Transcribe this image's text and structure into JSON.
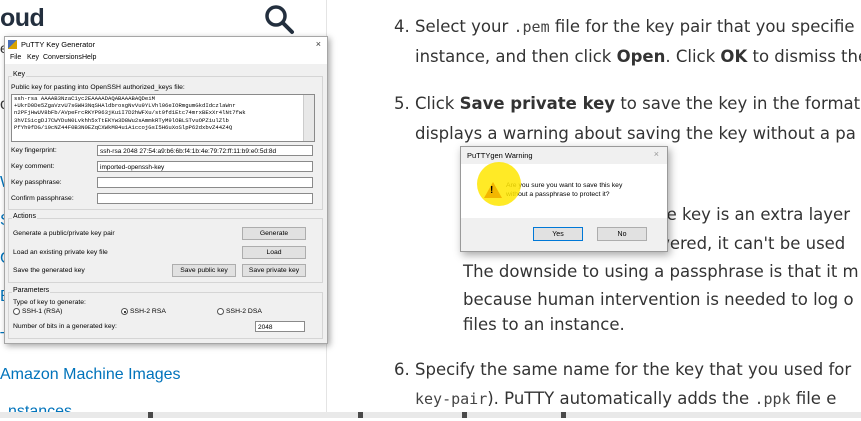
{
  "sidebar": {
    "brand": "oud",
    "fragments": [
      "er",
      "oc",
      "W",
      "Se",
      "Ge",
      "Be",
      "Tu"
    ],
    "links": [
      "Amazon Machine Images",
      "nstances"
    ]
  },
  "content": {
    "step4": {
      "num": "4.",
      "l1_a": "Select your ",
      "l1_code": ".pem",
      "l1_b": " file for the key pair that you specifie",
      "l2_a": "instance, and then click ",
      "l2_b1": "Open",
      "l2_c": ". Click ",
      "l2_b2": "OK",
      "l2_d": " to dismiss the"
    },
    "step5": {
      "num": "5.",
      "l1_a": "Click ",
      "l1_b": "Save private key",
      "l1_c": " to save the key in the format",
      "l2": "displays a warning about saving the key without a pa",
      "l3": "ate key is an extra layer",
      "l4": "overed, it can't be used",
      "l5": "The downside to using a passphrase is that it m",
      "l6": "because human intervention is needed to log o",
      "l7": "files to an instance."
    },
    "step6": {
      "num": "6.",
      "l1": "Specify the same name for the key that you used for",
      "l2_code": "key-pair",
      "l2_a": "). PuTTY automatically adds the ",
      "l2_code2": ".ppk",
      "l2_b": " file e"
    }
  },
  "putty": {
    "title": "PuTTY Key Generator",
    "close": "×",
    "menu": [
      "File",
      "Key",
      "Conversions",
      "Help"
    ],
    "key_group": "Key",
    "pubkey_label": "Public key for pasting into OpenSSH authorized_keys file:",
    "pubkey_lines": [
      "ssh-rsa AAAAB3NzaC1yc2EAAAADAQABAAABAQDeiM",
      "+UkrD0De5ZgaVzvU7sGWH3NqSHAldbrosgNvVu9YLVhl06eIORmgumGkdIdczlaWnr",
      "n2PFjHwUV8bFb/AVpeFrcRKYP963jKu1I7D2hWFXu/st9fd1Etc74mrxBExXr4lNt7fwk",
      "3hVISicgDJ7CWYDuN0Lvkhh5xTtEKYw3D8Wu2sAmmkRTyM9lOBLSTvuOPZiulZlb",
      "PfYh9fDG/19cNZ44F0B3N0EZqCXWkM84u1A1ccojGsI5H6uXoSlpP62dxbvZ44Z4Q"
    ],
    "fingerprint_label": "Key fingerprint:",
    "fingerprint_value": "ssh-rsa 2048 27:54:a9:b6:6b:f4:1b:4e:79:72:ff:11:b9:e0:5d:8d",
    "comment_label": "Key comment:",
    "comment_value": "imported-openssh-key",
    "passphrase_label": "Key passphrase:",
    "confirm_label": "Confirm passphrase:",
    "actions_group": "Actions",
    "gen_label": "Generate a public/private key pair",
    "gen_btn": "Generate",
    "load_label": "Load an existing private key file",
    "load_btn": "Load",
    "save_label": "Save the generated key",
    "save_pub_btn": "Save public key",
    "save_priv_btn": "Save private key",
    "params_group": "Parameters",
    "type_label": "Type of key to generate:",
    "types": [
      "SSH-1 (RSA)",
      "SSH-2 RSA",
      "SSH-2 DSA"
    ],
    "bits_label": "Number of bits in a generated key:",
    "bits_value": "2048"
  },
  "warning": {
    "title": "PuTTYgen Warning",
    "close": "×",
    "msg1": "Are you sure you want to save this key",
    "msg2": "without a passphrase to protect it?",
    "yes": "Yes",
    "no": "No"
  }
}
